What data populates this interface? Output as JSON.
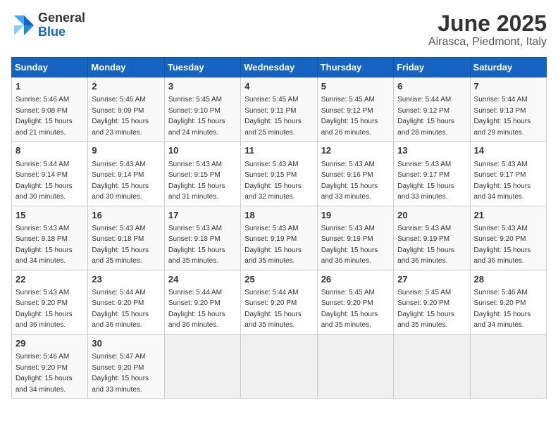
{
  "logo": {
    "general": "General",
    "blue": "Blue"
  },
  "title": "June 2025",
  "location": "Airasca, Piedmont, Italy",
  "days_of_week": [
    "Sunday",
    "Monday",
    "Tuesday",
    "Wednesday",
    "Thursday",
    "Friday",
    "Saturday"
  ],
  "weeks": [
    [
      {
        "day": "1",
        "sunrise": "5:46 AM",
        "sunset": "9:08 PM",
        "daylight": "15 hours and 21 minutes."
      },
      {
        "day": "2",
        "sunrise": "5:46 AM",
        "sunset": "9:09 PM",
        "daylight": "15 hours and 23 minutes."
      },
      {
        "day": "3",
        "sunrise": "5:45 AM",
        "sunset": "9:10 PM",
        "daylight": "15 hours and 24 minutes."
      },
      {
        "day": "4",
        "sunrise": "5:45 AM",
        "sunset": "9:11 PM",
        "daylight": "15 hours and 25 minutes."
      },
      {
        "day": "5",
        "sunrise": "5:45 AM",
        "sunset": "9:12 PM",
        "daylight": "15 hours and 26 minutes."
      },
      {
        "day": "6",
        "sunrise": "5:44 AM",
        "sunset": "9:12 PM",
        "daylight": "15 hours and 28 minutes."
      },
      {
        "day": "7",
        "sunrise": "5:44 AM",
        "sunset": "9:13 PM",
        "daylight": "15 hours and 29 minutes."
      }
    ],
    [
      {
        "day": "8",
        "sunrise": "5:44 AM",
        "sunset": "9:14 PM",
        "daylight": "15 hours and 30 minutes."
      },
      {
        "day": "9",
        "sunrise": "5:43 AM",
        "sunset": "9:14 PM",
        "daylight": "15 hours and 30 minutes."
      },
      {
        "day": "10",
        "sunrise": "5:43 AM",
        "sunset": "9:15 PM",
        "daylight": "15 hours and 31 minutes."
      },
      {
        "day": "11",
        "sunrise": "5:43 AM",
        "sunset": "9:15 PM",
        "daylight": "15 hours and 32 minutes."
      },
      {
        "day": "12",
        "sunrise": "5:43 AM",
        "sunset": "9:16 PM",
        "daylight": "15 hours and 33 minutes."
      },
      {
        "day": "13",
        "sunrise": "5:43 AM",
        "sunset": "9:17 PM",
        "daylight": "15 hours and 33 minutes."
      },
      {
        "day": "14",
        "sunrise": "5:43 AM",
        "sunset": "9:17 PM",
        "daylight": "15 hours and 34 minutes."
      }
    ],
    [
      {
        "day": "15",
        "sunrise": "5:43 AM",
        "sunset": "9:18 PM",
        "daylight": "15 hours and 34 minutes."
      },
      {
        "day": "16",
        "sunrise": "5:43 AM",
        "sunset": "9:18 PM",
        "daylight": "15 hours and 35 minutes."
      },
      {
        "day": "17",
        "sunrise": "5:43 AM",
        "sunset": "9:18 PM",
        "daylight": "15 hours and 35 minutes."
      },
      {
        "day": "18",
        "sunrise": "5:43 AM",
        "sunset": "9:19 PM",
        "daylight": "15 hours and 35 minutes."
      },
      {
        "day": "19",
        "sunrise": "5:43 AM",
        "sunset": "9:19 PM",
        "daylight": "15 hours and 36 minutes."
      },
      {
        "day": "20",
        "sunrise": "5:43 AM",
        "sunset": "9:19 PM",
        "daylight": "15 hours and 36 minutes."
      },
      {
        "day": "21",
        "sunrise": "5:43 AM",
        "sunset": "9:20 PM",
        "daylight": "15 hours and 36 minutes."
      }
    ],
    [
      {
        "day": "22",
        "sunrise": "5:43 AM",
        "sunset": "9:20 PM",
        "daylight": "15 hours and 36 minutes."
      },
      {
        "day": "23",
        "sunrise": "5:44 AM",
        "sunset": "9:20 PM",
        "daylight": "15 hours and 36 minutes."
      },
      {
        "day": "24",
        "sunrise": "5:44 AM",
        "sunset": "9:20 PM",
        "daylight": "15 hours and 36 minutes."
      },
      {
        "day": "25",
        "sunrise": "5:44 AM",
        "sunset": "9:20 PM",
        "daylight": "15 hours and 35 minutes."
      },
      {
        "day": "26",
        "sunrise": "5:45 AM",
        "sunset": "9:20 PM",
        "daylight": "15 hours and 35 minutes."
      },
      {
        "day": "27",
        "sunrise": "5:45 AM",
        "sunset": "9:20 PM",
        "daylight": "15 hours and 35 minutes."
      },
      {
        "day": "28",
        "sunrise": "5:46 AM",
        "sunset": "9:20 PM",
        "daylight": "15 hours and 34 minutes."
      }
    ],
    [
      {
        "day": "29",
        "sunrise": "5:46 AM",
        "sunset": "9:20 PM",
        "daylight": "15 hours and 34 minutes."
      },
      {
        "day": "30",
        "sunrise": "5:47 AM",
        "sunset": "9:20 PM",
        "daylight": "15 hours and 33 minutes."
      },
      null,
      null,
      null,
      null,
      null
    ]
  ],
  "labels": {
    "sunrise": "Sunrise: ",
    "sunset": "Sunset: ",
    "daylight": "Daylight: "
  }
}
